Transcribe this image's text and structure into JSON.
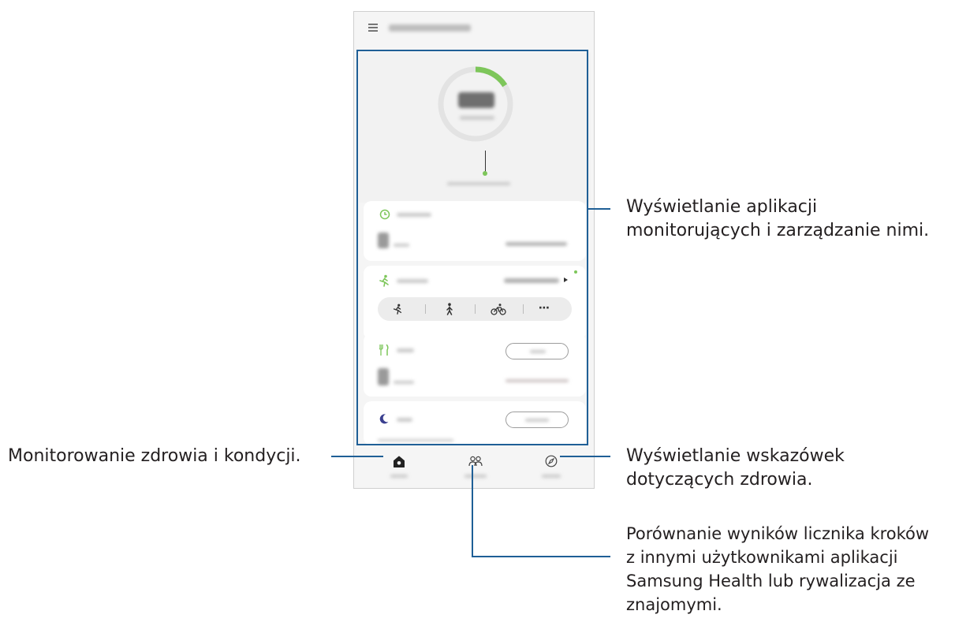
{
  "annotations": {
    "trackers": {
      "line1": "Wyświetlanie aplikacji",
      "line2": "monitorujących i zarządzanie nimi."
    },
    "home": {
      "line1": "Monitorowanie zdrowia i kondycji."
    },
    "discover": {
      "line1": "Wyświetlanie wskazówek",
      "line2": "dotyczących zdrowia."
    },
    "together": {
      "line1": "Porównanie wyników licznika kroków",
      "line2": "z innymi użytkownikami aplikacji",
      "line3": "Samsung Health lub rywalizacja ze",
      "line4": "znajomymi."
    }
  },
  "app": {
    "menu_icon": "hamburger-icon",
    "steps_progress": 0.16,
    "accent_color": "#7dc65a"
  },
  "trackers": {
    "clock_icon": "clock-icon",
    "exercise_icon": "running-icon",
    "food_icon": "fork-knife-icon",
    "sleep_icon": "moon-icon",
    "exercise_shortcuts": [
      {
        "icon": "running-icon"
      },
      {
        "icon": "walking-icon"
      },
      {
        "icon": "cycling-icon"
      },
      {
        "icon": "more-icon",
        "label": "⋯"
      }
    ]
  },
  "bottom_nav": {
    "home_icon": "home-icon",
    "together_icon": "people-icon",
    "discover_icon": "compass-icon"
  },
  "colors": {
    "callout_line": "#1f5f96",
    "accent": "#7dc65a"
  }
}
